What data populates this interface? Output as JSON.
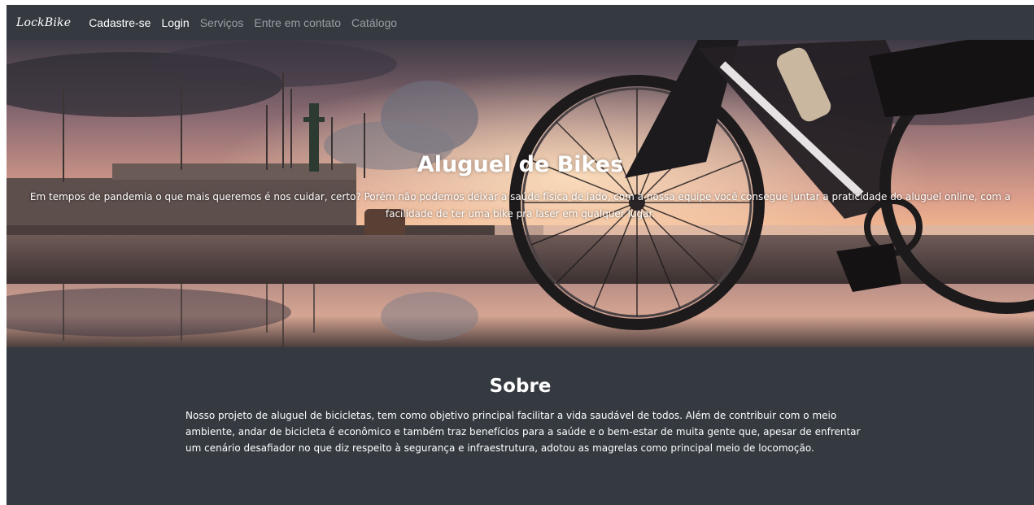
{
  "navbar": {
    "brand": "LockBike",
    "links": [
      {
        "label": "Cadastre-se",
        "active": true
      },
      {
        "label": "Login",
        "active": true
      },
      {
        "label": "Serviços",
        "active": false
      },
      {
        "label": "Entre em contato",
        "active": false
      },
      {
        "label": "Catálogo",
        "active": false
      }
    ]
  },
  "hero": {
    "title": "Aluguel de Bikes",
    "text": "Em tempos de pandemia o que mais queremos é nos cuidar, certo? Porém não podemos deixar a saúde física de lado, com a nossa equipe você consegue juntar a praticidade do aluguel online, com a facilidade de ter uma bike pra laser em qualquer lugar.",
    "image": "sunset-harbor-road-bike-photo"
  },
  "about": {
    "title": "Sobre",
    "text": "Nosso projeto de aluguel de bicicletas, tem como objetivo principal facilitar a vida saudável de todos. Além de contribuir com o meio ambiente, andar de bicicleta é econômico e também traz benefícios para a saúde e o bem-estar de muita gente que, apesar de enfrentar um cenário desafiador no que diz respeito à segurança e infraestrutura, adotou as magrelas como principal meio de locomoção."
  },
  "colors": {
    "background": "#343a40",
    "text": "#ffffff",
    "muted_link": "#9a9ea3"
  }
}
